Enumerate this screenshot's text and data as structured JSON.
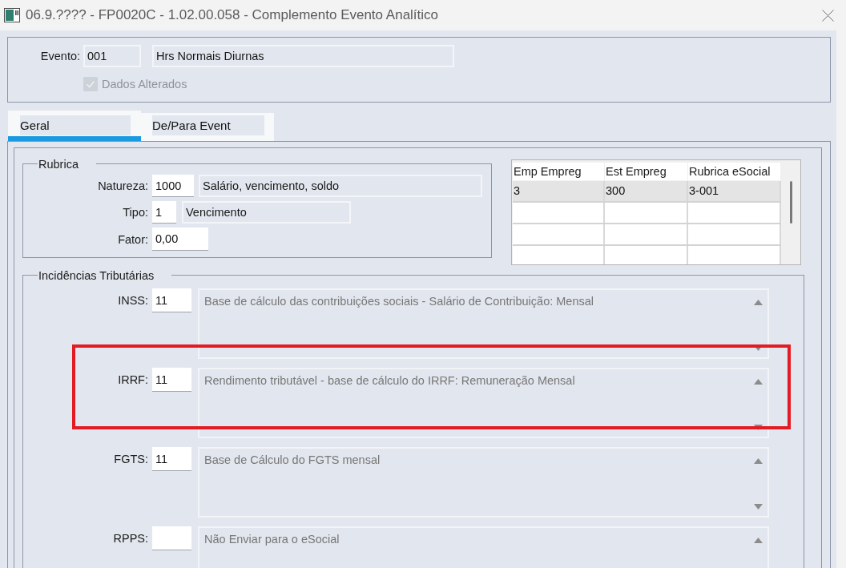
{
  "window": {
    "title": "06.9.???? - FP0020C - 1.02.00.058 - Complemento Evento Analítico"
  },
  "header": {
    "label": "Evento:",
    "code": "001",
    "description": "Hrs Normais Diurnas",
    "checkbox": {
      "label": "Dados Alterados",
      "checked": true,
      "disabled": true
    }
  },
  "tabs": [
    {
      "label": "Geral",
      "selected": true
    },
    {
      "label": "De/Para Event",
      "selected": false
    }
  ],
  "rubrica": {
    "title": "Rubrica",
    "fields": [
      {
        "label": "Natureza:",
        "value": "1000",
        "description": "Salário, vencimento, soldo"
      },
      {
        "label": "Tipo:",
        "value": "1",
        "description": "Vencimento"
      },
      {
        "label": "Fator:",
        "value": "0,00"
      }
    ]
  },
  "table": {
    "columns": [
      "Emp Empreg",
      "Est Empreg",
      "Rubrica eSocial"
    ],
    "rows": [
      {
        "cells": [
          "3",
          "300",
          "3-001"
        ],
        "selected": true
      }
    ]
  },
  "incidences": {
    "title": "Incidências Tributárias",
    "rows": [
      {
        "label": "INSS:",
        "value": "11",
        "description": "Base de cálculo das contribuições sociais - Salário de Contribuição: Mensal",
        "highlighted": false
      },
      {
        "label": "IRRF:",
        "value": "11",
        "description": "Rendimento tributável - base de cálculo do IRRF: Remuneração Mensal",
        "highlighted": true
      },
      {
        "label": "FGTS:",
        "value": "11",
        "description": "Base de Cálculo do FGTS mensal",
        "highlighted": false
      },
      {
        "label": "RPPS:",
        "description": "Não Enviar para o eSocial",
        "highlighted": false
      }
    ]
  }
}
